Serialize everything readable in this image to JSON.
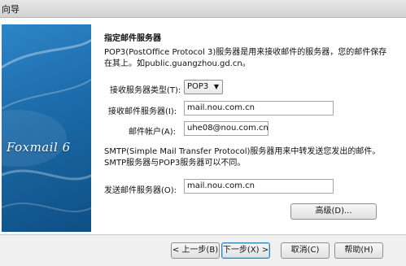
{
  "window": {
    "title": "向导"
  },
  "brand": {
    "logo_text": "Foxmail 6"
  },
  "page": {
    "section_title": "指定邮件服务器",
    "pop3_desc": [
      "POP3(PostOffice Protocol 3)服务器是用来接收邮件的服务器，您的邮件保存",
      "在其上。如public.guangzhou.gd.cn。"
    ],
    "smtp_desc": [
      "SMTP(Simple Mail Transfer Protocol)服务器用来中转发送您发出的邮件。",
      "SMTP服务器与POP3服务器可以不同。"
    ]
  },
  "form": {
    "server_type": {
      "label": "接收服务器类型(T):",
      "value": "POP3",
      "arrow": "▼"
    },
    "incoming_server": {
      "label": "接收邮件服务器(I):",
      "value": "mail.nou.com.cn"
    },
    "account": {
      "label": "邮件帐户(A):",
      "value": "uhe08@nou.com.cn"
    },
    "outgoing_server": {
      "label": "发送邮件服务器(O):",
      "value": "mail.nou.com.cn"
    }
  },
  "buttons": {
    "advanced": "高级(D)...",
    "back": "< 上一步(B)",
    "next": "下一步(X) >",
    "cancel": "取消(C)",
    "help": "帮助(H)"
  }
}
